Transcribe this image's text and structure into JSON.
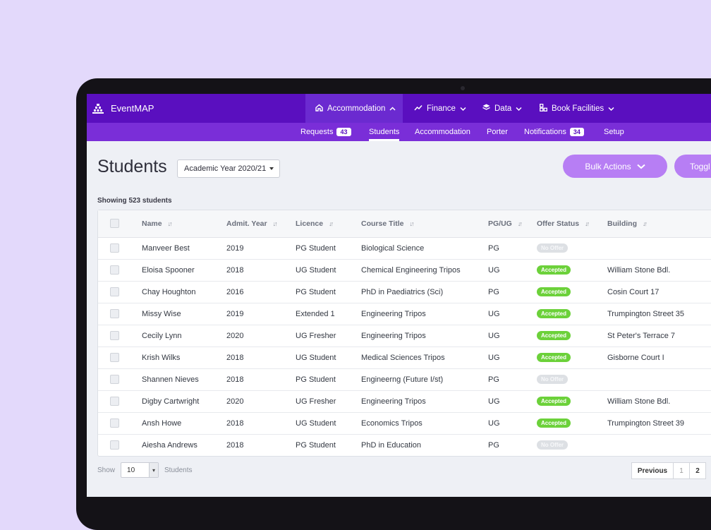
{
  "app": {
    "brand": "EventMAP",
    "menu": [
      {
        "label": "Accommodation",
        "icon": "home-icon",
        "active": true
      },
      {
        "label": "Finance",
        "icon": "trend-icon",
        "active": false
      },
      {
        "label": "Data",
        "icon": "layers-icon",
        "active": false
      },
      {
        "label": "Book Facilities",
        "icon": "grid-icon",
        "active": false
      }
    ],
    "subnav": [
      {
        "label": "Requests",
        "badge": "43",
        "active": false
      },
      {
        "label": "Students",
        "badge": null,
        "active": true
      },
      {
        "label": "Accommodation",
        "badge": null,
        "active": false
      },
      {
        "label": "Porter",
        "badge": null,
        "active": false
      },
      {
        "label": "Notifications",
        "badge": "34",
        "active": false
      },
      {
        "label": "Setup",
        "badge": null,
        "active": false
      }
    ]
  },
  "page": {
    "title": "Students",
    "year_select": "Academic Year 2020/21",
    "bulk_actions": "Bulk Actions",
    "toggle": "Toggl",
    "showing": "Showing 523 students"
  },
  "table": {
    "headers": [
      "Name",
      "Admit. Year",
      "Licence",
      "Course Title",
      "PG/UG",
      "Offer Status",
      "Building"
    ],
    "rows": [
      {
        "name": "Manveer Best",
        "year": "2019",
        "licence": "PG Student",
        "course": "Biological Science",
        "level": "PG",
        "status": "No Offer",
        "building": ""
      },
      {
        "name": "Eloisa Spooner",
        "year": "2018",
        "licence": "UG Student",
        "course": "Chemical Engineering Tripos",
        "level": "UG",
        "status": "Accepted",
        "building": "William Stone Bdl."
      },
      {
        "name": "Chay Houghton",
        "year": "2016",
        "licence": "PG Student",
        "course": "PhD in Paediatrics (Sci)",
        "level": "PG",
        "status": "Accepted",
        "building": "Cosin Court 17"
      },
      {
        "name": "Missy Wise",
        "year": "2019",
        "licence": "Extended 1",
        "course": "Engineering Tripos",
        "level": "UG",
        "status": "Accepted",
        "building": "Trumpington Street 35"
      },
      {
        "name": "Cecily Lynn",
        "year": "2020",
        "licence": "UG Fresher",
        "course": "Engineering Tripos",
        "level": "UG",
        "status": "Accepted",
        "building": "St Peter's Terrace 7"
      },
      {
        "name": "Krish Wilks",
        "year": "2018",
        "licence": "UG Student",
        "course": "Medical Sciences Tripos",
        "level": "UG",
        "status": "Accepted",
        "building": "Gisborne Court I"
      },
      {
        "name": "Shannen Nieves",
        "year": "2018",
        "licence": "PG Student",
        "course": "Engineerng (Future I/st)",
        "level": "PG",
        "status": "No Offer",
        "building": ""
      },
      {
        "name": "Digby Cartwright",
        "year": "2020",
        "licence": "UG Fresher",
        "course": "Engineering Tripos",
        "level": "UG",
        "status": "Accepted",
        "building": "William Stone Bdl."
      },
      {
        "name": "Ansh Howe",
        "year": "2018",
        "licence": "UG Student",
        "course": "Economics Tripos",
        "level": "UG",
        "status": "Accepted",
        "building": "Trumpington Street 39"
      },
      {
        "name": "Aiesha Andrews",
        "year": "2018",
        "licence": "PG Student",
        "course": "PhD in Education",
        "level": "PG",
        "status": "No Offer",
        "building": ""
      }
    ]
  },
  "footer": {
    "show_label": "Show",
    "per_page": "10",
    "students_label": "Students",
    "previous": "Previous",
    "pages": [
      "1",
      "2"
    ]
  },
  "colors": {
    "nav": "#5a0fbf",
    "subnav": "#7a2ed8",
    "button": "#b77ef4",
    "accepted": "#6cd13a",
    "background": "#e3d9fb"
  }
}
